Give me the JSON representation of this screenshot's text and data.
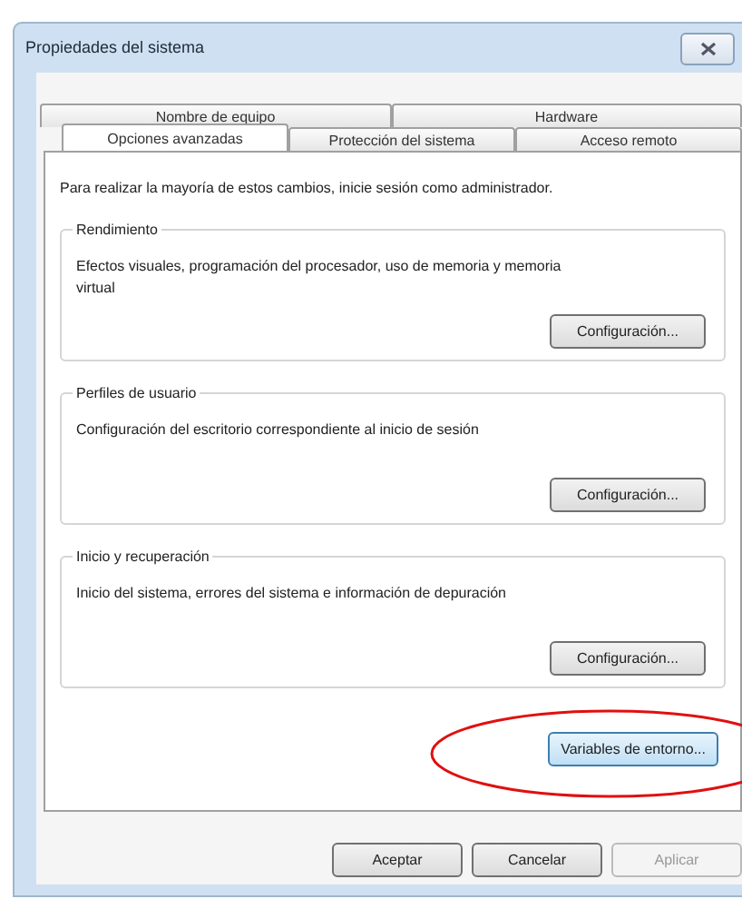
{
  "window": {
    "title": "Propiedades del sistema"
  },
  "tab_rows": [
    {
      "tabs": [
        {
          "label": "Nombre de equipo",
          "selected": false
        },
        {
          "label": "Hardware",
          "selected": false
        }
      ]
    },
    {
      "tabs": [
        {
          "label": "Opciones avanzadas",
          "selected": true
        },
        {
          "label": "Protección del sistema",
          "selected": false
        },
        {
          "label": "Acceso remoto",
          "selected": false
        }
      ]
    }
  ],
  "notice": "Para realizar la mayoría de estos cambios, inicie sesión como administrador.",
  "groups": [
    {
      "title": "Rendimiento",
      "description": "Efectos visuales, programación del procesador, uso de memoria y memoria virtual",
      "button": "Configuración..."
    },
    {
      "title": "Perfiles de usuario",
      "description": "Configuración del escritorio correspondiente al inicio de sesión",
      "button": "Configuración..."
    },
    {
      "title": "Inicio y recuperación",
      "description": "Inicio del sistema, errores del sistema e información de depuración",
      "button": "Configuración..."
    }
  ],
  "env_button": {
    "label": "Variables de entorno...",
    "highlighted": true
  },
  "buttons": [
    {
      "label": "Aceptar",
      "disabled": false
    },
    {
      "label": "Cancelar",
      "disabled": false
    },
    {
      "label": "Aplicar",
      "disabled": true
    }
  ]
}
